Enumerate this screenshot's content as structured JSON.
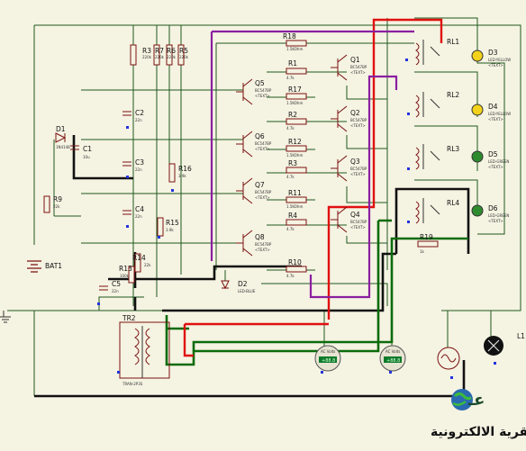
{
  "components": {
    "R18": {
      "name": "R18",
      "value": "1.5KOhm"
    },
    "R17": {
      "name": "R17",
      "value": "1.5KOhm"
    },
    "R12": {
      "name": "R12",
      "value": "1.5KOhm"
    },
    "R11": {
      "name": "R11",
      "value": "1.5KOhm"
    },
    "R1": {
      "name": "R1",
      "value": "4.7k"
    },
    "R2": {
      "name": "R2",
      "value": "4.7k"
    },
    "R9": {
      "name": "R9",
      "value": "22k"
    },
    "R10": {
      "name": "R10",
      "value": "4.7k"
    },
    "R3": {
      "name": "R3",
      "value": "220k"
    },
    "R7": {
      "name": "R7",
      "value": "220k"
    },
    "R6": {
      "name": "R6",
      "value": "220k"
    },
    "R5": {
      "name": "R5",
      "value": "220k"
    },
    "R16": {
      "name": "R16",
      "value": "3.9k"
    },
    "R15": {
      "name": "R15",
      "value": "3.9k"
    },
    "R14": {
      "name": "R14",
      "value": "22k"
    },
    "R13": {
      "name": "R13",
      "value": "100k"
    },
    "R19": {
      "name": "R19",
      "value": "1k"
    },
    "R4": {
      "name": "R4",
      "value": "4.7k"
    },
    "C1": {
      "name": "C1",
      "value": "10u"
    },
    "C2": {
      "name": "C2",
      "value": "22n"
    },
    "C3": {
      "name": "C3",
      "value": "22n"
    },
    "C4": {
      "name": "C4",
      "value": "22n"
    },
    "C5": {
      "name": "C5",
      "value": "22n"
    },
    "D1": {
      "name": "D1",
      "value": "1N4148"
    },
    "D2": {
      "name": "D2",
      "value": "LED-BLUE"
    },
    "Q1": {
      "name": "Q1",
      "value": "BC547BP"
    },
    "Q2": {
      "name": "Q2",
      "value": "BC547BP"
    },
    "Q3": {
      "name": "Q3",
      "value": "BC547BP"
    },
    "Q4": {
      "name": "Q4",
      "value": "BC547BP"
    },
    "Q5": {
      "name": "Q5",
      "value": "BC547BP"
    },
    "Q6": {
      "name": "Q6",
      "value": "BC547BP"
    },
    "Q7": {
      "name": "Q7",
      "value": "BC547BP"
    },
    "Q8": {
      "name": "Q8",
      "value": "BC547BP"
    },
    "RL1": {
      "name": "RL1"
    },
    "RL2": {
      "name": "RL2"
    },
    "RL3": {
      "name": "RL3"
    },
    "RL4": {
      "name": "RL4"
    },
    "D3": {
      "name": "D3",
      "value": "LED-YELLOW"
    },
    "D4": {
      "name": "D4",
      "value": "LED-YELLOW"
    },
    "D5": {
      "name": "D5",
      "value": "LED-GREEN"
    },
    "D6": {
      "name": "D6",
      "value": "LED-GREEN"
    },
    "BAT1": {
      "name": "BAT1"
    },
    "TR2": {
      "name": "TR2",
      "value": "TRAN-2P3S"
    },
    "L1": {
      "name": "L1"
    }
  },
  "placeholder": "<TEXT>",
  "meters": {
    "m1": {
      "unit": "AC Volts",
      "reading": "+88.8"
    },
    "m2": {
      "unit": "AC Volts",
      "reading": "+88.8"
    }
  },
  "watermark": "القرية الالكترونية",
  "colors": {
    "background": "#f5f3e2",
    "wire": "#1f5a1f",
    "component": "#7a1010",
    "highlight_black": "#111111",
    "highlight_green": "#0b6b0b",
    "highlight_red": "#e01010",
    "highlight_purple": "#8a1fa0",
    "pin_marker": "#2233dd"
  }
}
